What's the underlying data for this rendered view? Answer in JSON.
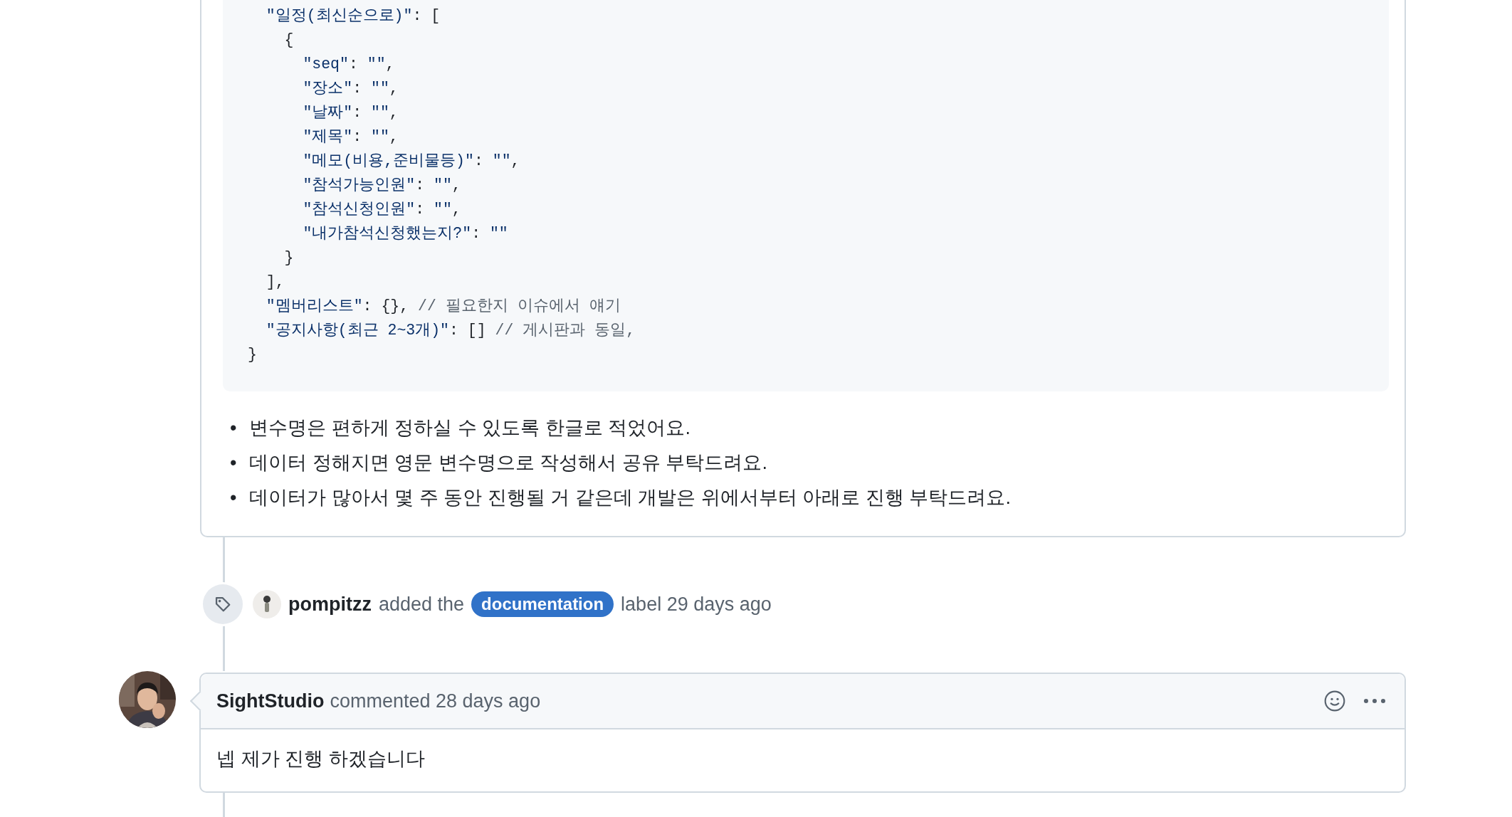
{
  "code_block": {
    "lines": [
      {
        "tokens": [
          {
            "kind": "key",
            "text": "  \"일정(최신순으로)\""
          },
          {
            "kind": "plain",
            "text": ": ["
          }
        ]
      },
      {
        "tokens": [
          {
            "kind": "plain",
            "text": "    {"
          }
        ]
      },
      {
        "tokens": [
          {
            "kind": "key",
            "text": "      \"seq\""
          },
          {
            "kind": "plain",
            "text": ": "
          },
          {
            "kind": "key",
            "text": "\"\""
          },
          {
            "kind": "plain",
            "text": ","
          }
        ]
      },
      {
        "tokens": [
          {
            "kind": "key",
            "text": "      \"장소\""
          },
          {
            "kind": "plain",
            "text": ": "
          },
          {
            "kind": "key",
            "text": "\"\""
          },
          {
            "kind": "plain",
            "text": ","
          }
        ]
      },
      {
        "tokens": [
          {
            "kind": "key",
            "text": "      \"날짜\""
          },
          {
            "kind": "plain",
            "text": ": "
          },
          {
            "kind": "key",
            "text": "\"\""
          },
          {
            "kind": "plain",
            "text": ","
          }
        ]
      },
      {
        "tokens": [
          {
            "kind": "key",
            "text": "      \"제목\""
          },
          {
            "kind": "plain",
            "text": ": "
          },
          {
            "kind": "key",
            "text": "\"\""
          },
          {
            "kind": "plain",
            "text": ","
          }
        ]
      },
      {
        "tokens": [
          {
            "kind": "key",
            "text": "      \"메모(비용,준비물등)\""
          },
          {
            "kind": "plain",
            "text": ": "
          },
          {
            "kind": "key",
            "text": "\"\""
          },
          {
            "kind": "plain",
            "text": ","
          }
        ]
      },
      {
        "tokens": [
          {
            "kind": "key",
            "text": "      \"참석가능인원\""
          },
          {
            "kind": "plain",
            "text": ": "
          },
          {
            "kind": "key",
            "text": "\"\""
          },
          {
            "kind": "plain",
            "text": ","
          }
        ]
      },
      {
        "tokens": [
          {
            "kind": "key",
            "text": "      \"참석신청인원\""
          },
          {
            "kind": "plain",
            "text": ": "
          },
          {
            "kind": "key",
            "text": "\"\""
          },
          {
            "kind": "plain",
            "text": ","
          }
        ]
      },
      {
        "tokens": [
          {
            "kind": "key",
            "text": "      \"내가참석신청했는지?\""
          },
          {
            "kind": "plain",
            "text": ": "
          },
          {
            "kind": "key",
            "text": "\"\""
          }
        ]
      },
      {
        "tokens": [
          {
            "kind": "plain",
            "text": "    }"
          }
        ]
      },
      {
        "tokens": [
          {
            "kind": "plain",
            "text": "  ],"
          }
        ]
      },
      {
        "tokens": [
          {
            "kind": "key",
            "text": "  \"멤버리스트\""
          },
          {
            "kind": "plain",
            "text": ": {}, "
          },
          {
            "kind": "comment",
            "text": "// 필요한지 이슈에서 얘기"
          }
        ]
      },
      {
        "tokens": [
          {
            "kind": "key",
            "text": "  \"공지사항(최근 2~3개)\""
          },
          {
            "kind": "plain",
            "text": ": [] "
          },
          {
            "kind": "comment",
            "text": "// 게시판과 동일,"
          }
        ]
      },
      {
        "tokens": [
          {
            "kind": "plain",
            "text": "}"
          }
        ]
      }
    ]
  },
  "notes": [
    {
      "marker": "•",
      "text": "변수명은 편하게 정하실 수 있도록 한글로 적었어요."
    },
    {
      "marker": "•",
      "text": "데이터 정해지면 영문 변수명으로 작성해서 공유 부탁드려요."
    },
    {
      "marker": "•",
      "text": "데이터가 많아서 몇 주 동안 진행될 거 같은데 개발은 위에서부터 아래로 진행 부탁드려요."
    }
  ],
  "timeline": [
    {
      "kind": "label_event",
      "actor": "pompitzz",
      "action": "added the",
      "label": "documentation",
      "suffix": "label 29 days ago"
    },
    {
      "kind": "comment",
      "author": "SightStudio",
      "action": "commented 28 days ago",
      "body": "넵 제가 진행 하겠습니다"
    }
  ]
}
